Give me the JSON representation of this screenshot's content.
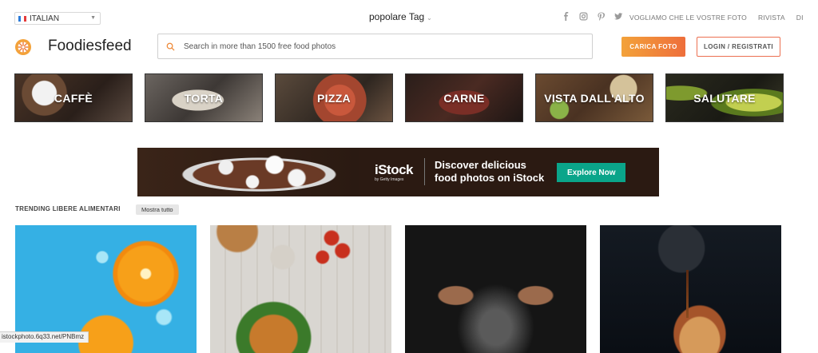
{
  "topbar": {
    "language": "ITALIAN",
    "tag_menu": "popolare Tag",
    "links": [
      "VOGLIAMO CHE LE VOSTRE FOTO",
      "RIVISTA",
      "DI"
    ]
  },
  "header": {
    "logo_text": "Foodiesfeed",
    "search_placeholder": "Search in more than 1500 free food photos",
    "upload_label": "CARICA FOTO",
    "login_label": "LOGIN / REGISTRATI"
  },
  "categories": [
    "CAFFÈ",
    "TORTA",
    "PIZZA",
    "CARNE",
    "VISTA DALL'ALTO",
    "SALUTARE"
  ],
  "banner": {
    "logo": "iStock",
    "logo_sub": "by Getty Images",
    "line1": "Discover delicious",
    "line2": "food photos on iStock",
    "cta": "Explore Now"
  },
  "trending": {
    "title": "TRENDING LIBERE ALIMENTARI",
    "show_all": "Mostra tutto"
  },
  "status_bar": "istockphoto.6q33.net/PNBmz",
  "colors": {
    "accent_start": "#f3a23a",
    "accent_end": "#ee6e3b",
    "istock_green": "#0aa58a"
  }
}
